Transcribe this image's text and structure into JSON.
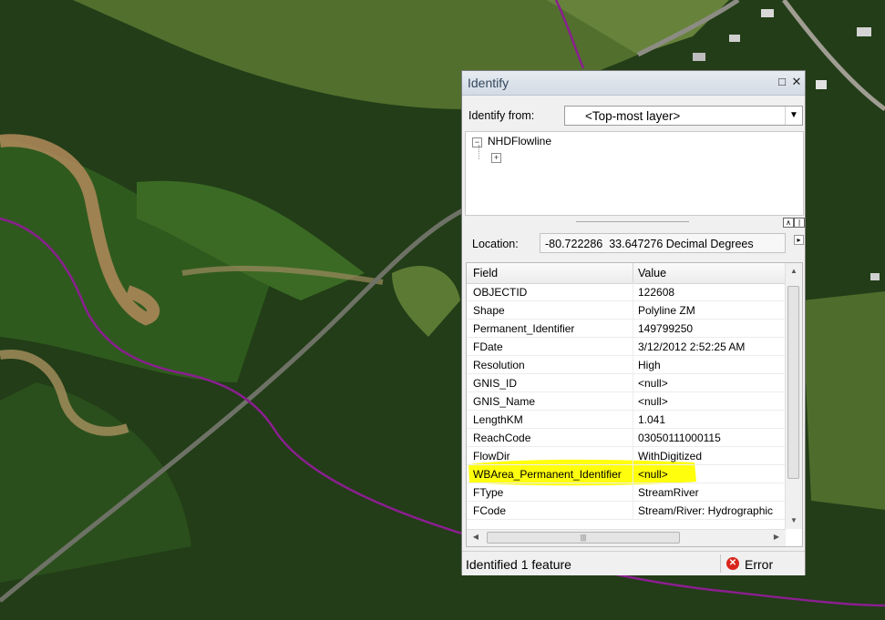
{
  "window": {
    "title": "Identify",
    "maximize_icon": "maximize-icon",
    "close_icon": "close-icon"
  },
  "identify_from": {
    "label": "Identify from:",
    "value": "<Top-most layer>"
  },
  "tree": {
    "layer": "NHDFlowline"
  },
  "location": {
    "label": "Location:",
    "value": "-80.722286  33.647276 Decimal Degrees"
  },
  "grid": {
    "headers": [
      "Field",
      "Value"
    ],
    "rows": [
      {
        "field": "OBJECTID",
        "value": "122608"
      },
      {
        "field": "Shape",
        "value": "Polyline ZM"
      },
      {
        "field": "Permanent_Identifier",
        "value": "149799250"
      },
      {
        "field": "FDate",
        "value": "3/12/2012 2:52:25 AM"
      },
      {
        "field": "Resolution",
        "value": "High"
      },
      {
        "field": "GNIS_ID",
        "value": "<null>"
      },
      {
        "field": "GNIS_Name",
        "value": "<null>"
      },
      {
        "field": "LengthKM",
        "value": "1.041"
      },
      {
        "field": "ReachCode",
        "value": "03050111000115"
      },
      {
        "field": "FlowDir",
        "value": "WithDigitized"
      },
      {
        "field": "WBArea_Permanent_Identifier",
        "value": "<null>"
      },
      {
        "field": "FType",
        "value": "StreamRiver"
      },
      {
        "field": "FCode",
        "value": "Stream/River: Hydrographic"
      }
    ],
    "highlight_color": "#ffff00"
  },
  "status": {
    "text": "Identified 1 feature",
    "error_label": "Error"
  },
  "colors": {
    "flowline": "#8a1f8f",
    "title_text": "#33475c"
  }
}
